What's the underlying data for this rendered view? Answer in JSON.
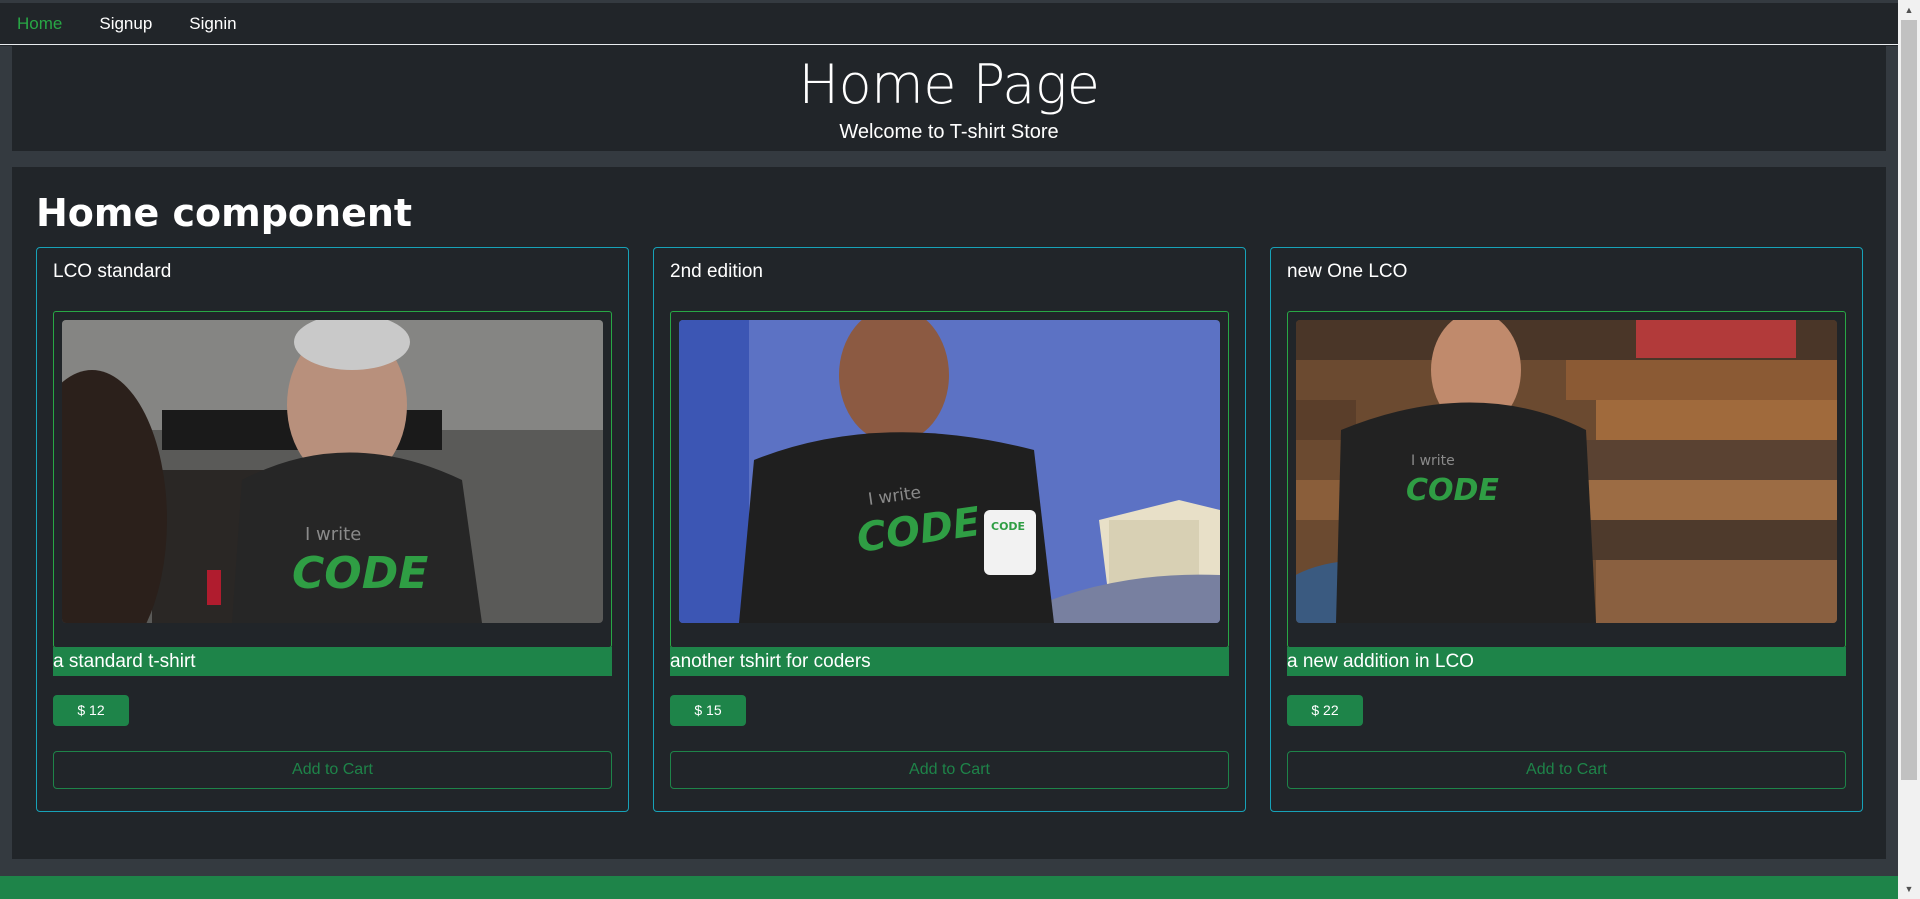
{
  "nav": {
    "items": [
      {
        "label": "Home",
        "active": true
      },
      {
        "label": "Signup",
        "active": false
      },
      {
        "label": "Signin",
        "active": false
      }
    ]
  },
  "jumbotron": {
    "title": "Home Page",
    "subtitle": "Welcome to T-shirt Store"
  },
  "main": {
    "heading": "Home component",
    "products": [
      {
        "name": "LCO standard",
        "description": "a standard t-shirt",
        "price": "$ 12",
        "cart_label": "Add to Cart",
        "image": "man-in-code-tshirt-photo"
      },
      {
        "name": "2nd edition",
        "description": "another tshirt for coders",
        "price": "$ 15",
        "cart_label": "Add to Cart",
        "image": "man-with-code-mug-photo"
      },
      {
        "name": "new One LCO",
        "description": "a new addition in LCO",
        "price": "$ 22",
        "cart_label": "Add to Cart",
        "image": "man-by-wood-wall-photo"
      }
    ]
  },
  "colors": {
    "background": "#212529",
    "frame": "#343a40",
    "accent_green": "#1e8449",
    "nav_active": "#28a745",
    "card_border": "#17a2b8"
  }
}
